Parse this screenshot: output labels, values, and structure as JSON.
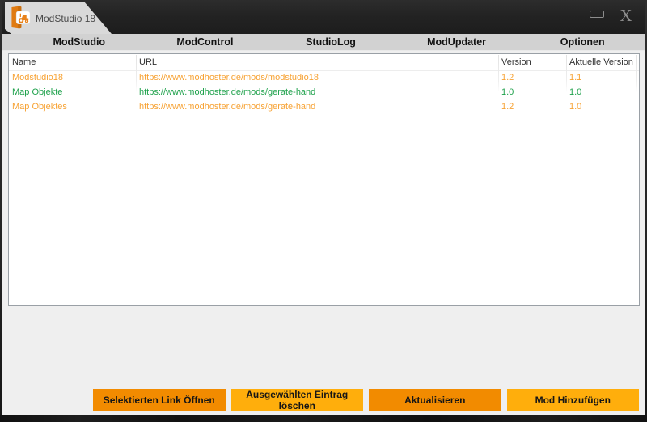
{
  "window": {
    "title": "ModStudio 18",
    "close_glyph": "X"
  },
  "menu": {
    "items": [
      {
        "label": "ModStudio"
      },
      {
        "label": "ModControl"
      },
      {
        "label": "StudioLog"
      },
      {
        "label": "ModUpdater"
      },
      {
        "label": "Optionen"
      }
    ]
  },
  "table": {
    "columns": [
      {
        "label": "Name"
      },
      {
        "label": "URL"
      },
      {
        "label": "Version"
      },
      {
        "label": "Aktuelle Version"
      }
    ],
    "rows": [
      {
        "name": "Modstudio18",
        "url": "https://www.modhoster.de/mods/modstudio18",
        "version": "1.2",
        "aktuelle_version": "1.1",
        "color": "#f7a233"
      },
      {
        "name": "Map Objekte",
        "url": "https://www.modhoster.de/mods/gerate-hand",
        "version": "1.0",
        "aktuelle_version": "1.0",
        "color": "#1ea14b"
      },
      {
        "name": "Map Objektes",
        "url": "https://www.modhoster.de/mods/gerate-hand",
        "version": "1.2",
        "aktuelle_version": "1.0",
        "color": "#f7a233"
      }
    ]
  },
  "buttons": [
    {
      "label": "Selektierten Link Öffnen",
      "color": "#f28b00"
    },
    {
      "label": "Ausgewählten Eintrag löschen",
      "color": "#ffae0c"
    },
    {
      "label": "Aktualisieren",
      "color": "#f28b00"
    },
    {
      "label": "Mod Hinzufügen",
      "color": "#ffae0c"
    }
  ],
  "colors": {
    "titlebar": "#232323",
    "menubar": "#d2d2d2",
    "content_bg": "#efefef",
    "table_border": "#9aa0a6",
    "orange_text": "#f7a233",
    "green_text": "#1ea14b"
  }
}
